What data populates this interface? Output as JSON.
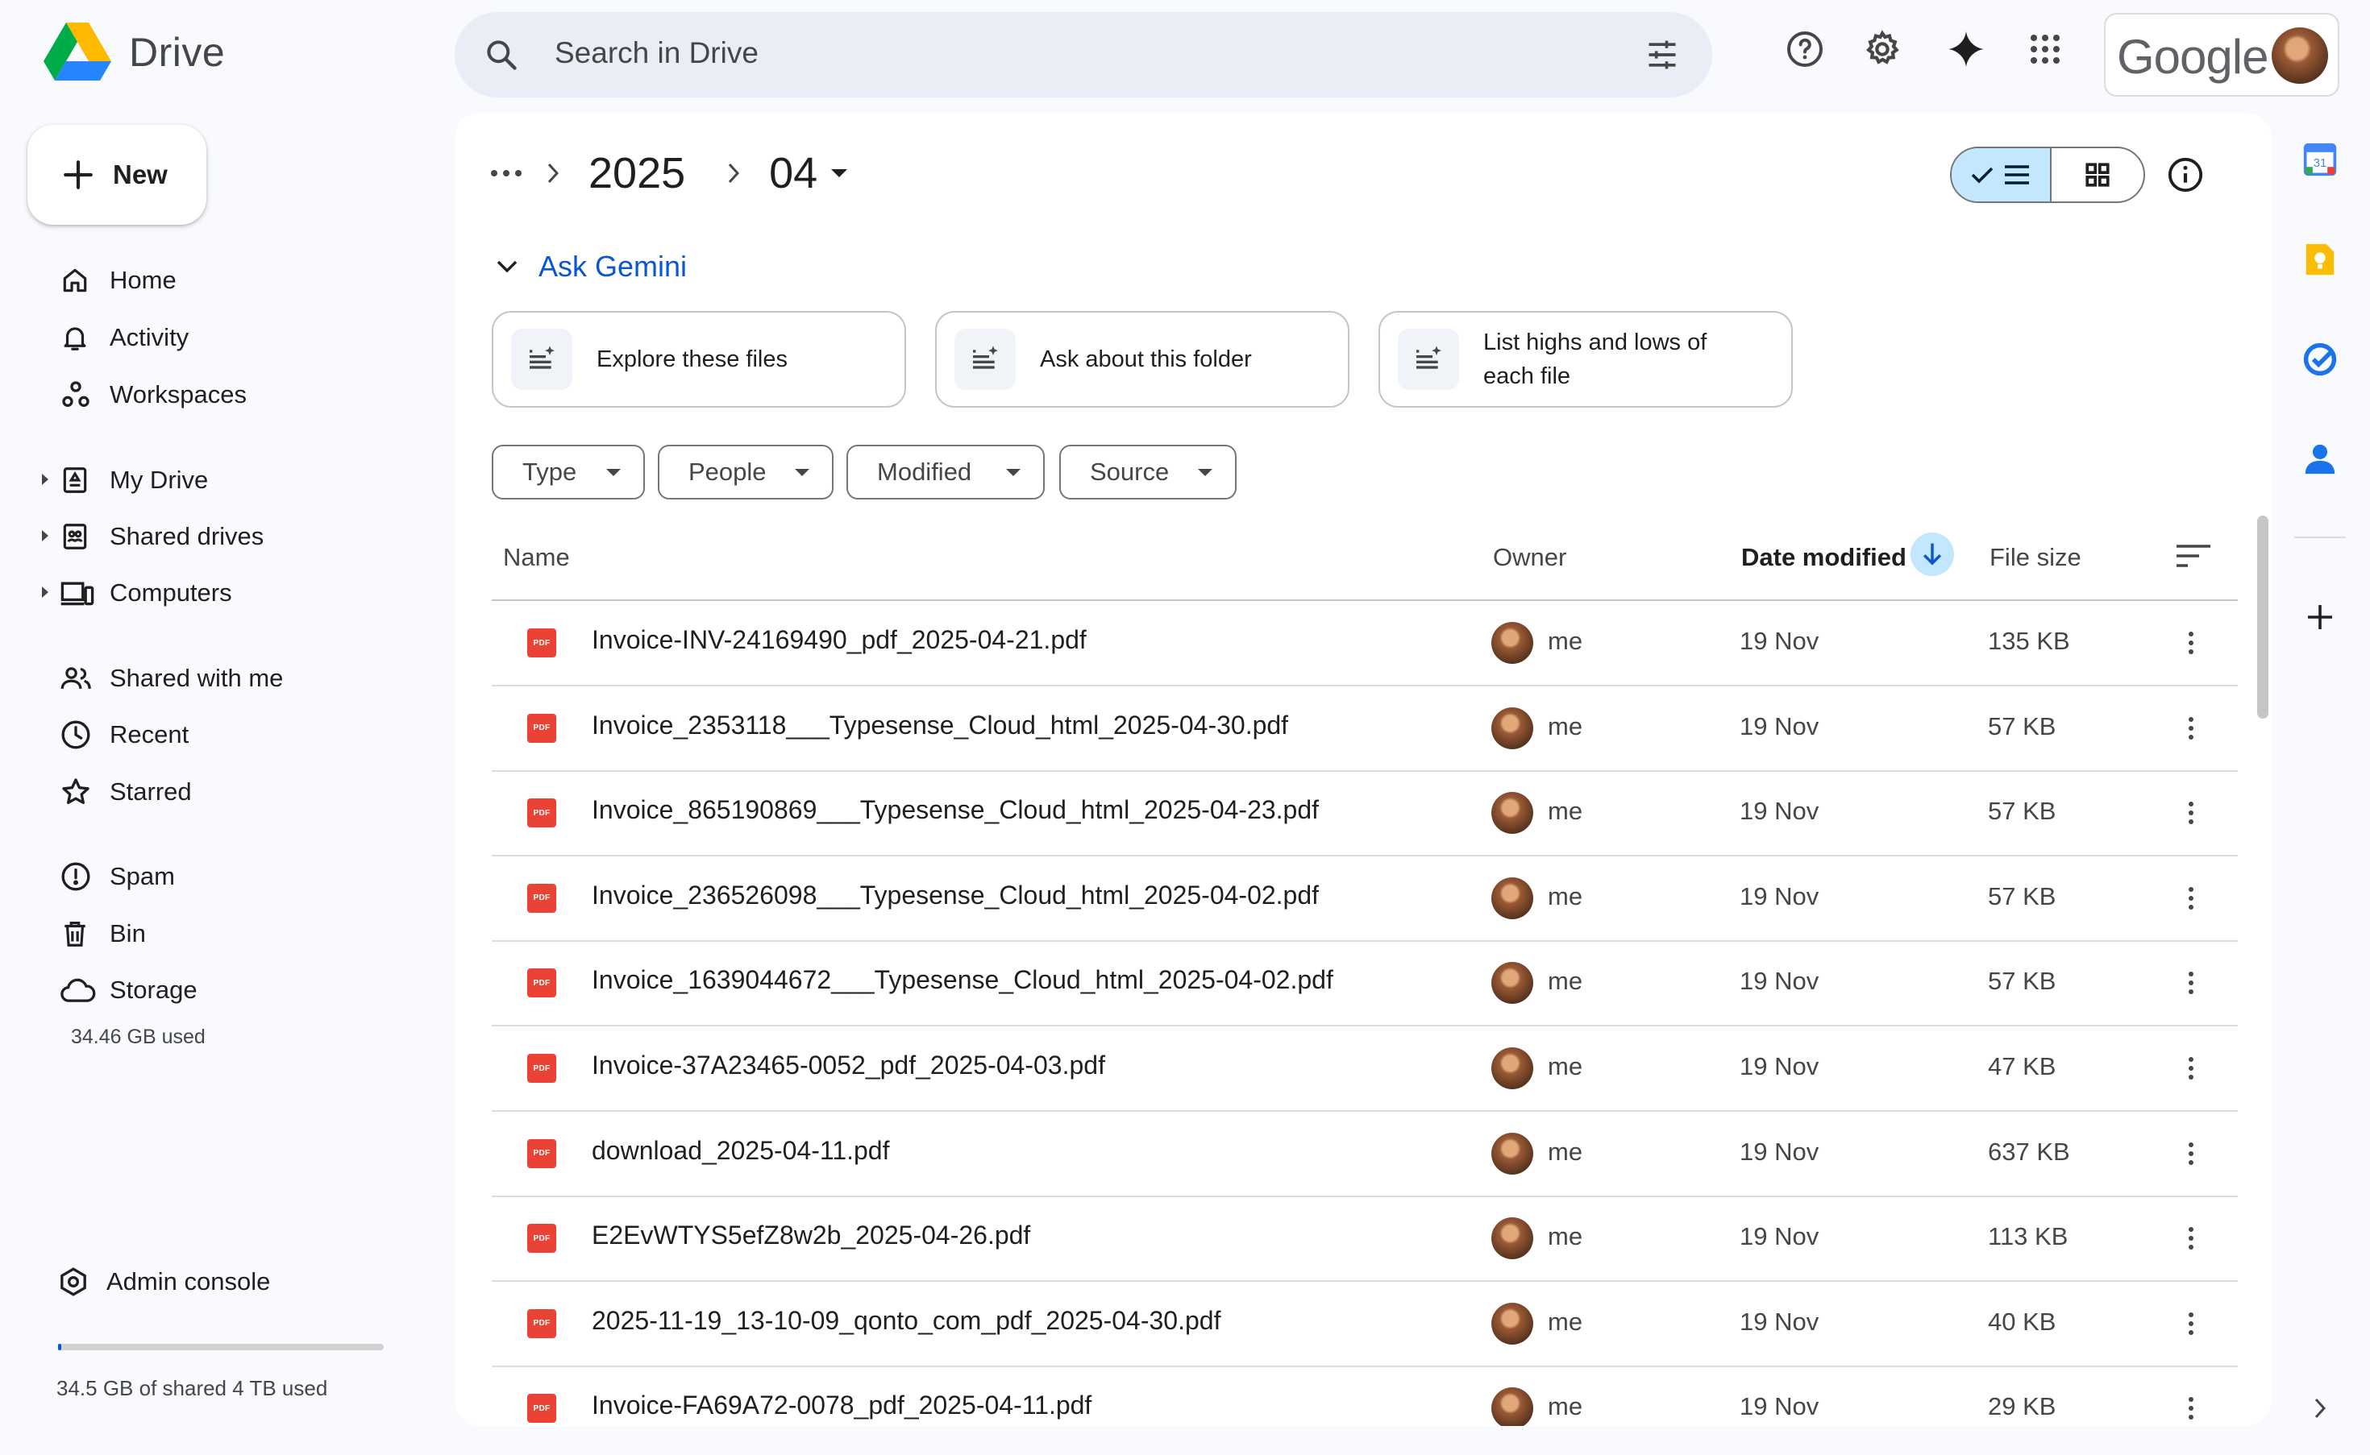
{
  "app": {
    "name": "Drive"
  },
  "search": {
    "placeholder": "Search in Drive"
  },
  "account": {
    "brand": "Google"
  },
  "new_button": {
    "label": "New"
  },
  "nav": {
    "items": [
      {
        "label": "Home",
        "icon": "home-icon"
      },
      {
        "label": "Activity",
        "icon": "bell-icon"
      },
      {
        "label": "Workspaces",
        "icon": "workspaces-icon"
      },
      {
        "label": "My Drive",
        "icon": "my-drive-icon"
      },
      {
        "label": "Shared drives",
        "icon": "shared-drives-icon"
      },
      {
        "label": "Computers",
        "icon": "computers-icon"
      },
      {
        "label": "Shared with me",
        "icon": "people-icon"
      },
      {
        "label": "Recent",
        "icon": "clock-icon"
      },
      {
        "label": "Starred",
        "icon": "star-icon"
      },
      {
        "label": "Spam",
        "icon": "spam-icon"
      },
      {
        "label": "Bin",
        "icon": "trash-icon"
      },
      {
        "label": "Storage",
        "icon": "cloud-icon"
      }
    ],
    "storage_used": "34.46 GB used",
    "admin_console": "Admin console",
    "shared_storage": "34.5 GB of shared 4 TB used",
    "shared_storage_fraction": 0.0086
  },
  "breadcrumb": {
    "ellipsis": "•••",
    "parent": "2025",
    "current": "04"
  },
  "gemini": {
    "label": "Ask Gemini",
    "suggestions": [
      "Explore these files",
      "Ask about this folder",
      "List highs and lows of each file"
    ]
  },
  "filters": [
    "Type",
    "People",
    "Modified",
    "Source"
  ],
  "table": {
    "headers": {
      "name": "Name",
      "owner": "Owner",
      "date_modified": "Date modified",
      "file_size": "File size"
    },
    "file_badge": "PDF",
    "rows": [
      {
        "name": "Invoice-INV-24169490_pdf_2025-04-21.pdf",
        "owner": "me",
        "date": "19 Nov",
        "size": "135 KB"
      },
      {
        "name": "Invoice_2353118___Typesense_Cloud_html_2025-04-30.pdf",
        "owner": "me",
        "date": "19 Nov",
        "size": "57 KB"
      },
      {
        "name": "Invoice_865190869___Typesense_Cloud_html_2025-04-23.pdf",
        "owner": "me",
        "date": "19 Nov",
        "size": "57 KB"
      },
      {
        "name": "Invoice_236526098___Typesense_Cloud_html_2025-04-02.pdf",
        "owner": "me",
        "date": "19 Nov",
        "size": "57 KB"
      },
      {
        "name": "Invoice_1639044672___Typesense_Cloud_html_2025-04-02.pdf",
        "owner": "me",
        "date": "19 Nov",
        "size": "57 KB"
      },
      {
        "name": "Invoice-37A23465-0052_pdf_2025-04-03.pdf",
        "owner": "me",
        "date": "19 Nov",
        "size": "47 KB"
      },
      {
        "name": "download_2025-04-11.pdf",
        "owner": "me",
        "date": "19 Nov",
        "size": "637 KB"
      },
      {
        "name": "E2EvWTYS5efZ8w2b_2025-04-26.pdf",
        "owner": "me",
        "date": "19 Nov",
        "size": "113 KB"
      },
      {
        "name": "2025-11-19_13-10-09_qonto_com_pdf_2025-04-30.pdf",
        "owner": "me",
        "date": "19 Nov",
        "size": "40 KB"
      },
      {
        "name": "Invoice-FA69A72-0078_pdf_2025-04-11.pdf",
        "owner": "me",
        "date": "19 Nov",
        "size": "29 KB"
      }
    ]
  },
  "right_rail": {
    "calendar_day": "31"
  },
  "colors": {
    "accent": "#0b57d0",
    "selected": "#c2e7ff",
    "pdf": "#ea4335",
    "background": "#f8fafd"
  }
}
